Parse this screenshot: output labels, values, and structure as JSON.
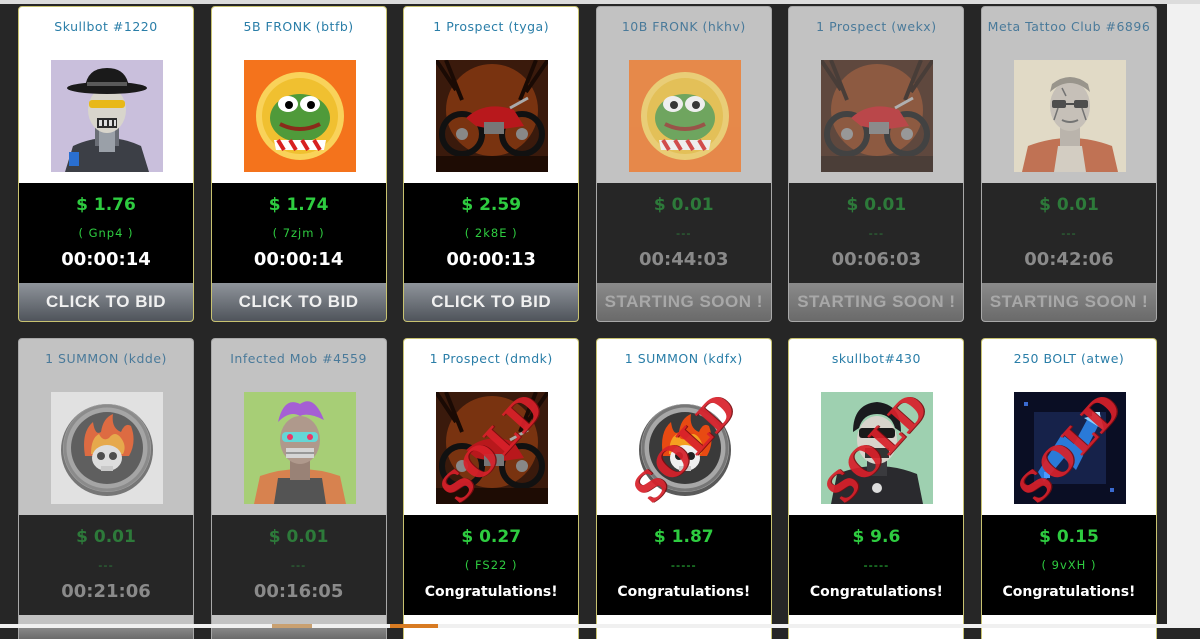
{
  "auctions": [
    {
      "title": "Skullbot #1220",
      "price": "$ 1.76",
      "code": "( Gnp4 )",
      "timer": "00:00:14",
      "action": "CLICK TO BID",
      "state": "live",
      "image": "skullbot-cowboy-image"
    },
    {
      "title": "5B FRONK (btfb)",
      "price": "$ 1.74",
      "code": "( 7zjm )",
      "timer": "00:00:14",
      "action": "CLICK TO BID",
      "state": "live",
      "image": "pepe-frog-coin-image"
    },
    {
      "title": "1 Prospect (tyga)",
      "price": "$ 2.59",
      "code": "( 2k8E )",
      "timer": "00:00:13",
      "action": "CLICK TO BID",
      "state": "live",
      "image": "motorcycle-image"
    },
    {
      "title": "10B FRONK (hkhv)",
      "price": "$ 0.01",
      "code": "---",
      "timer": "00:44:03",
      "action": "STARTING SOON !",
      "state": "soon",
      "image": "pepe-frog-coin-image"
    },
    {
      "title": "1 Prospect (wekx)",
      "price": "$ 0.01",
      "code": "---",
      "timer": "00:06:03",
      "action": "STARTING SOON !",
      "state": "soon",
      "image": "motorcycle-image"
    },
    {
      "title": "Meta Tattoo Club #6896",
      "price": "$ 0.01",
      "code": "---",
      "timer": "00:42:06",
      "action": "STARTING SOON !",
      "state": "soon",
      "image": "tattooed-man-image"
    },
    {
      "title": "1 SUMMON (kdde)",
      "price": "$ 0.01",
      "code": "---",
      "timer": "00:21:06",
      "action": "",
      "state": "soon-row2",
      "image": "summon-skull-coin-image"
    },
    {
      "title": "Infected Mob #4559",
      "price": "$ 0.01",
      "code": "---",
      "timer": "00:16:05",
      "action": "",
      "state": "soon-row2",
      "image": "infected-mob-image"
    },
    {
      "title": "1 Prospect (dmdk)",
      "price": "$ 0.27",
      "code": "( FS22 )",
      "result": "Congratulations!",
      "state": "sold",
      "image": "motorcycle-image",
      "stamp": "SOLD"
    },
    {
      "title": "1 SUMMON (kdfx)",
      "price": "$ 1.87",
      "code": "-----",
      "result": "Congratulations!",
      "state": "sold",
      "image": "summon-skull-coin-image",
      "stamp": "SOLD"
    },
    {
      "title": "skullbot#430",
      "price": "$ 9.6",
      "code": "-----",
      "result": "Congratulations!",
      "state": "sold",
      "image": "skullbot-hood-image",
      "stamp": "SOLD"
    },
    {
      "title": "250 BOLT (atwe)",
      "price": "$ 0.15",
      "code": "( 9vXH )",
      "result": "Congratulations!",
      "state": "sold",
      "image": "bolt-token-image",
      "stamp": "SOLD"
    }
  ],
  "colors": {
    "price_green": "#2ecc40",
    "title_blue": "#2a7ea8",
    "sold_red": "#d8202a",
    "card_border": "#c8c270"
  }
}
